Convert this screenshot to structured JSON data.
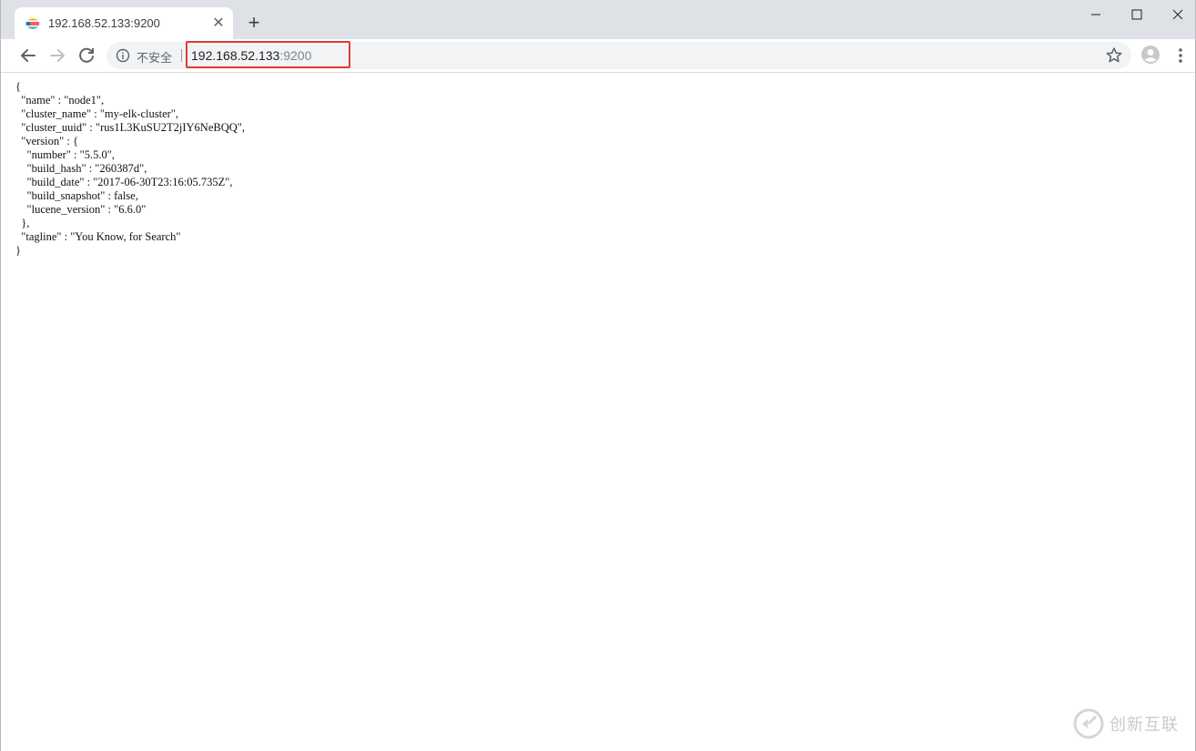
{
  "tab": {
    "title": "192.168.52.133:9200",
    "favicon": "elastic-logo-icon"
  },
  "omnibox": {
    "security_label": "不安全",
    "host": "192.168.52.133",
    "port": ":9200"
  },
  "page": {
    "json_text": "{\n  \"name\" : \"node1\",\n  \"cluster_name\" : \"my-elk-cluster\",\n  \"cluster_uuid\" : \"rus1L3KuSU2T2jIY6NeBQQ\",\n  \"version\" : {\n    \"number\" : \"5.5.0\",\n    \"build_hash\" : \"260387d\",\n    \"build_date\" : \"2017-06-30T23:16:05.735Z\",\n    \"build_snapshot\" : false,\n    \"lucene_version\" : \"6.6.0\"\n  },\n  \"tagline\" : \"You Know, for Search\"\n}"
  },
  "watermark": {
    "text": "创新互联"
  },
  "colors": {
    "titlebar": "#dee1e6",
    "highlight": "#e53935"
  }
}
